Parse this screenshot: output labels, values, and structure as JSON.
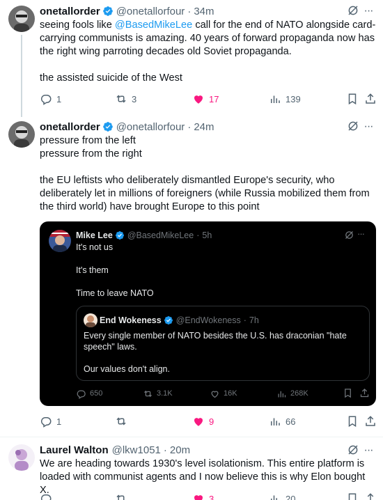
{
  "tweets": [
    {
      "name": "onetallorder",
      "handle": "@onetallorfour",
      "time": "34m",
      "text_before_mention": "seeing fools like ",
      "mention": "@BasedMikeLee",
      "text_after_mention": " call for the end of NATO alongside card-carrying communists is amazing. 40 years of forward propaganda now has the right wing parroting decades old Soviet propaganda.",
      "text_line2": "the assisted suicide of the West",
      "replies": "1",
      "reposts": "3",
      "likes": "17",
      "views": "139"
    },
    {
      "name": "onetallorder",
      "handle": "@onetallorfour",
      "time": "24m",
      "text_line1": "pressure from the left",
      "text_line2": "pressure from the right",
      "text_para2": "the EU leftists who deliberately dismantled Europe's security, who deliberately let in millions of foreigners (while Russia mobilized them from the third world) have brought Europe to this point",
      "replies": "1",
      "reposts": "",
      "likes": "9",
      "views": "66"
    },
    {
      "name": "Laurel Walton",
      "handle": "@lkw1051",
      "time": "20m",
      "text": "We are heading towards 1930's level isolationism. This entire platform is loaded with communist agents and I now believe this is why Elon bought X.",
      "replies": "",
      "reposts": "",
      "likes": "3",
      "views": "20"
    }
  ],
  "quote": {
    "name": "Mike Lee",
    "handle": "@BasedMikeLee",
    "time": "5h",
    "line1": "It's not us",
    "line2": "It's them",
    "line3": "Time to leave NATO",
    "inner": {
      "name": "End Wokeness",
      "handle": "@EndWokeness",
      "time": "7h",
      "text1": "Every single member of NATO besides the U.S. has draconian \"hate speech\" laws.",
      "text2": "Our values don't align."
    },
    "replies": "650",
    "reposts": "3.1K",
    "likes": "16K",
    "views": "268K"
  },
  "separator": "·",
  "more_glyph": "···",
  "colors": {
    "accent": "#1d9bf0",
    "like": "#f91880",
    "muted": "#536471"
  }
}
